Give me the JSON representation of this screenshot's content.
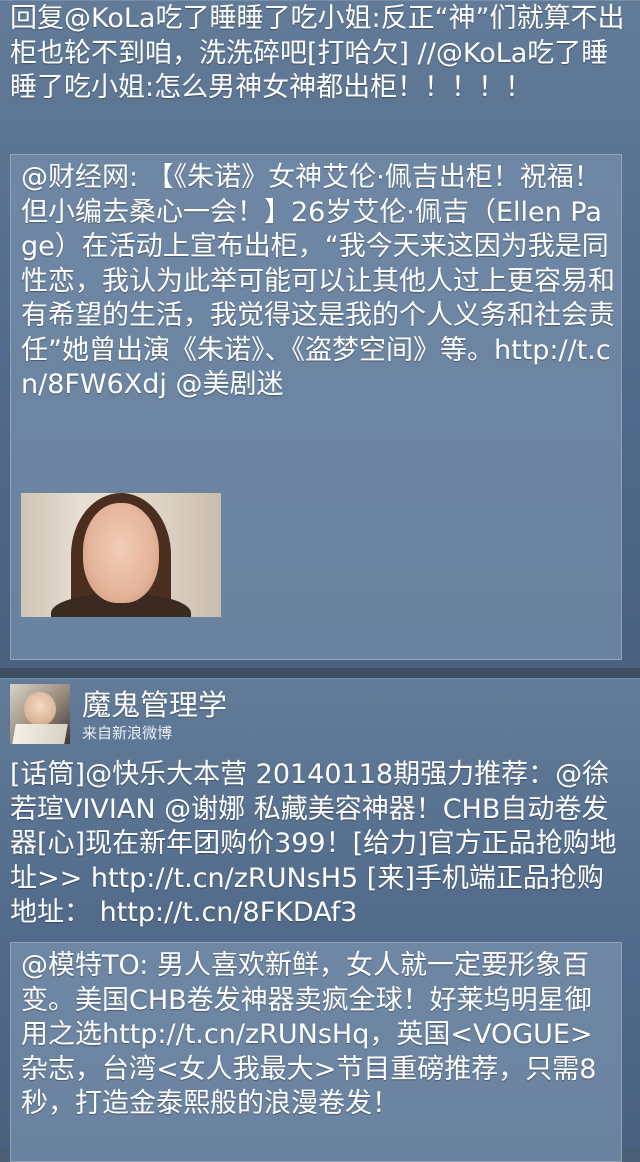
{
  "post1": {
    "reply_text": "回复@KoLa吃了睡睡了吃小姐:反正“神”们就算不出柜也轮不到咱，洗洗碎吧[打哈欠] //@KoLa吃了睡睡了吃小姐:怎么男神女神都出柜！！！！！",
    "quoted_text": "@财经网: 【《朱诺》女神艾伦·佩吉出柜！祝福！但小编去桑心一会！】26岁艾伦·佩吉（Ellen Page）在活动上宣布出柜，“我今天来这因为我是同性恋，我认为此举可能可以让其他人过上更容易和有希望的生活，我觉得这是我的个人义务和社会责任”她曾出演《朱诺》、《盗梦空间》等。http://t.cn/8FW6Xdj @美剧迷"
  },
  "post2": {
    "user_name": "魔鬼管理学",
    "source": "来自新浪微博",
    "text": "[话筒]@快乐大本营 20140118期强力推荐：@徐若瑄VIVIAN @谢娜 私藏美容神器！CHB自动卷发器[心]现在新年团购价399！[给力]官方正品抢购地址>> http://t.cn/zRUNsH5 [来]手机端正品抢购地址： http://t.cn/8FKDAf3",
    "quoted_text": "@模特TO: 男人喜欢新鲜，女人就一定要形象百变。美国CHB卷发神器卖疯全球！好莱坞明星御用之选http://t.cn/zRUNsHq，英国<VOGUE>杂志，台湾<女人我最大>节目重磅推荐，只需8秒，打造金泰熙般的浪漫卷发！"
  }
}
